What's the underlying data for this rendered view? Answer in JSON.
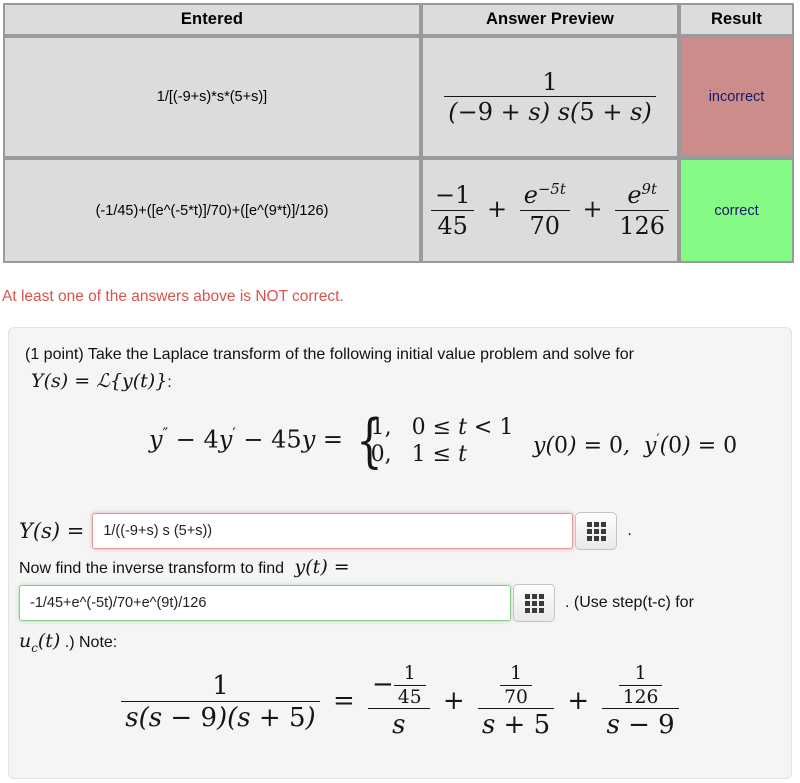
{
  "results_table": {
    "headers": [
      "Entered",
      "Answer Preview",
      "Result"
    ],
    "rows": [
      {
        "entered": "1/[(-9+s)*s*(5+s)]",
        "preview_latex": "\\frac{1}{(-9+s)\\,s(5+s)}",
        "preview": {
          "numerator": "1",
          "denominator": "(-9 + s) s(5 + s)"
        },
        "result": "incorrect",
        "result_state": "incorrect",
        "result_color": "#cd8c8c",
        "result_text_color": "#151b66"
      },
      {
        "entered": "(-1/45)+([e^(-5*t)]/70)+([e^(9*t)]/126)",
        "preview_latex": "\\frac{-1}{45}+\\frac{e^{-5t}}{70}+\\frac{e^{9t}}{126}",
        "preview": {
          "terms": [
            {
              "numerator": "-1",
              "denominator": "45"
            },
            {
              "numerator": "e^{-5t}",
              "denominator": "70"
            },
            {
              "numerator": "e^{9t}",
              "denominator": "126"
            }
          ],
          "operators": [
            "+",
            "+"
          ]
        },
        "result": "correct",
        "result_state": "correct",
        "result_color": "#85fa85",
        "result_text_color": "#151b66"
      }
    ]
  },
  "alert": {
    "message": "At least one of the answers above is NOT correct.",
    "color": "#d9534f"
  },
  "problem": {
    "points_label": "(1 point)",
    "prompt_part1": "(1 point) Take the Laplace transform of the following initial value problem and solve for",
    "prompt_math": "Y(s) = L{y(t)}",
    "prompt_colon": ":",
    "equation": {
      "lhs": "y'' − 4y' − 45y",
      "equals": "=",
      "cases": [
        {
          "value": "1,",
          "condition": "0 ≤ t < 1"
        },
        {
          "value": "0,",
          "condition": "1 ≤ t"
        }
      ],
      "initial_conditions": "y(0) = 0,  y'(0) = 0"
    },
    "answer1": {
      "label": "Y(s) =",
      "value": "1/((-9+s) s (5+s))",
      "state": "incorrect",
      "trailing": ".",
      "keypad_icon": "keypad-icon"
    },
    "inverse_prompt": "Now find the inverse transform to find",
    "inverse_prompt_math": "y(t) =",
    "answer2": {
      "value": "-1/45+e^(-5t)/70+e^(9t)/126",
      "state": "correct",
      "hint": ". (Use step(t-c) for",
      "keypad_icon": "keypad-icon"
    },
    "note_math": "u_c(t)",
    "note_text": ".) Note:",
    "identity": {
      "lhs": {
        "numerator": "1",
        "denominator": "s(s − 9)(s + 5)"
      },
      "equals": "=",
      "terms": [
        {
          "numerator": "−1/45",
          "num_sign": "−",
          "num_frac_num": "1",
          "num_frac_den": "45",
          "denominator": "s"
        },
        {
          "numerator": "1/70",
          "num_sign": "",
          "num_frac_num": "1",
          "num_frac_den": "70",
          "denominator": "s + 5"
        },
        {
          "numerator": "1/126",
          "num_sign": "",
          "num_frac_num": "1",
          "num_frac_den": "126",
          "denominator": "s − 9"
        }
      ],
      "operators": [
        "+",
        "+"
      ]
    }
  }
}
